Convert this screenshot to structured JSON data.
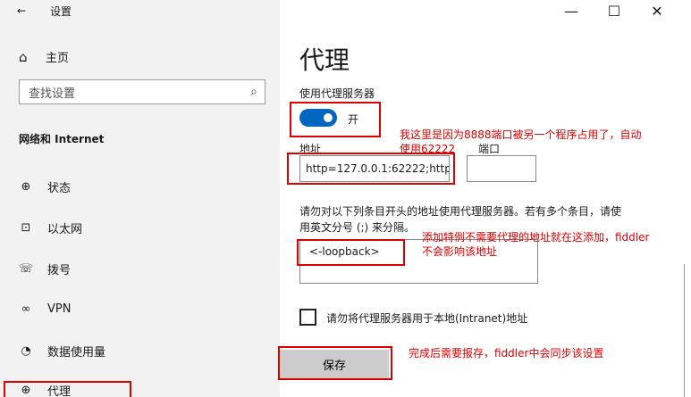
{
  "window": {
    "back_glyph": "←",
    "title": "设置",
    "min_glyph": "—",
    "max_glyph": "☐",
    "close_glyph": "✕"
  },
  "sidebar": {
    "home": {
      "icon": "home-icon",
      "glyph": "⌂",
      "label": "主页"
    },
    "search": {
      "placeholder": "查找设置",
      "icon": "search-icon",
      "glyph": "⌕"
    },
    "section": "网络和 Internet",
    "items": [
      {
        "icon": "globe-status-icon",
        "glyph": "⊕",
        "label": "状态"
      },
      {
        "icon": "ethernet-icon",
        "glyph": "⊡",
        "label": "以太网"
      },
      {
        "icon": "dialup-icon",
        "glyph": "☏",
        "label": "拨号"
      },
      {
        "icon": "vpn-icon",
        "glyph": "∞",
        "label": "VPN"
      },
      {
        "icon": "data-usage-icon",
        "glyph": "◔",
        "label": "数据使用量"
      },
      {
        "icon": "proxy-icon",
        "glyph": "⊕",
        "label": "代理"
      }
    ]
  },
  "main": {
    "title": "代理",
    "use_proxy_label": "使用代理服务器",
    "toggle_state": "开",
    "address_label": "地址",
    "port_label": "端口",
    "address_value": "http=127.0.0.1:62222;http",
    "port_value": "",
    "exceptions_desc_line1": "请勿对以下列条目开头的地址使用代理服务器。若有多个条目，请使",
    "exceptions_desc_line2": "用英文分号 (;) 来分隔。",
    "exceptions_value": "<-loopback>",
    "local_checkbox_label": "请勿将代理服务器用于本地(Intranet)地址",
    "save_label": "保存"
  },
  "annotations": {
    "note1_line1": "我这里是因为8888端口被另一个程序占用了，自动",
    "note1_line2": "使用62222",
    "note2_line1": "添加特例不需要代理的地址就在这添加，fiddler",
    "note2_line2": "不会影响该地址",
    "note3": "完成后需要报存，fiddler中会同步该设置",
    "color": "#e00000"
  },
  "colors": {
    "accent": "#0067c0",
    "sidebar_bg": "#f2f2f2",
    "button_bg": "#cccccc"
  }
}
